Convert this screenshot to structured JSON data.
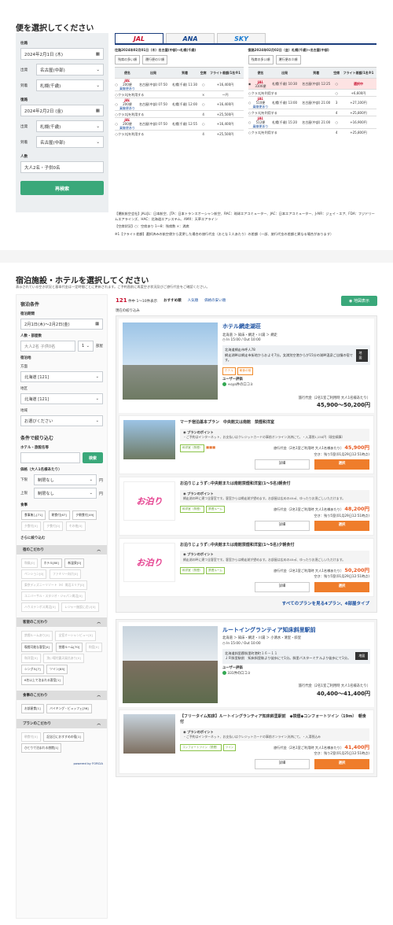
{
  "flight": {
    "title": "便を選択してください",
    "outbound_label": "往路",
    "outbound_date": "2024年2月1日 (木)",
    "dep_label": "出発",
    "arr_label": "到着",
    "out_dep": "名古屋(中部)",
    "out_arr": "札幌(千歳)",
    "return_label": "復路",
    "return_date": "2024年2月2日 (金)",
    "ret_dep": "札幌(千歳)",
    "ret_arr": "名古屋(中部)",
    "people_label": "人数",
    "people_value": "大人2名・子供0名",
    "search_button": "再検索",
    "tabs": [
      "JAL",
      "ANA",
      "SKY"
    ],
    "out_header": "往路2024年02月01日（木）名古屋(中部)→札幌(千歳)",
    "ret_header": "復路2024年02月02日（金）札幌(千歳)→名古屋(中部)",
    "sort_buttons": [
      "残席の多い順",
      "運行便の少順"
    ],
    "cols": [
      "便名",
      "出発",
      "到着",
      "空席",
      "フライト差額/1名※1"
    ],
    "out_rows": [
      {
        "flight": "JAL",
        "no": "200便",
        "link": "乗継便あり",
        "dep": "名古屋(中部) 07:50",
        "arr": "札幌(千歳) 11:30",
        "seat": "○",
        "diff": "+16,400円"
      },
      {
        "cls": "クラスJを利用する",
        "diff": "ー円",
        "seat": "×"
      },
      {
        "flight": "JAL",
        "no": "200便",
        "link": "乗継便あり",
        "dep": "名古屋(中部) 07:50",
        "arr": "札幌(千歳) 12:00",
        "seat": "○",
        "diff": "+16,400円"
      },
      {
        "cls": "クラスJを利用する",
        "seat": "4",
        "diff": "+25,500円"
      },
      {
        "flight": "JAL",
        "no": "200便",
        "link": "乗継便あり",
        "dep": "名古屋(中部) 07:50",
        "arr": "札幌(千歳) 12:55",
        "seat": "○",
        "diff": "+16,400円"
      },
      {
        "cls": "クラスJを利用する",
        "seat": "4",
        "diff": "+25,500円"
      }
    ],
    "ret_rows": [
      {
        "flight": "JAL",
        "no": "3106便",
        "dep": "札幌(千歳) 10:30",
        "arr": "名古屋(中部) 12:25",
        "seat": "○",
        "diff": "選択中"
      },
      {
        "cls": "クラスJを利用する",
        "seat": "○",
        "diff": "+6,600円"
      },
      {
        "flight": "JAL",
        "no": "510便",
        "link": "乗継便あり",
        "dep": "札幌(千歳) 13:00",
        "arr": "名古屋(中部) 21:00",
        "seat": "3",
        "diff": "+27,100円"
      },
      {
        "cls": "クラスJを利用する",
        "seat": "4",
        "diff": "+25,800円"
      },
      {
        "flight": "JAL",
        "no": "512便",
        "link": "乗継便あり",
        "dep": "札幌(千歳) 15:20",
        "arr": "名古屋(中部) 21:00",
        "seat": "○",
        "diff": "+16,900円"
      },
      {
        "cls": "クラスJを利用する",
        "seat": "4",
        "diff": "+25,800円"
      }
    ],
    "note1": "【運航航空会社】JAL/JL：日本航空、JTA：日本トランスオーシャン航空、RAC：琉球エアコミューター、JAC：日本エアコミューター、J-AIR：ジェイ・エア、FDA：フジドリームエアラインズ、HAC：北海道エアシステム、AMX：天草エアライン",
    "note2": "【空席状況】○：空席あり 1～8：残席数 ×：満席",
    "note3": "※1【フライト差額】選択済みの航空便から変更した場合の旅行代金（おとな１人あたり）の差額（一部、旅行代金の差額と異なる場合があります）"
  },
  "hotel": {
    "title": "宿泊施設・ホテルを選択してください",
    "subtitle": "表示されている空き状況と基本代金は一定時間ごとに更新されます。ご予約直前に再度空き状況及びご旅行代金をご確認ください。",
    "cond_title": "宿泊条件",
    "period_label": "宿泊期間",
    "period_value": "2月1日(木)〜2月2日(金)",
    "people_label": "人数・部屋数",
    "people_value": "大人2名 子供0名",
    "rooms_value": "1",
    "rooms_unit": "部屋",
    "area_label": "宿泊地",
    "dir_label": "方面",
    "dir_value": "北海道 [121]",
    "region_label": "地区",
    "region_value": "北海道 [121]",
    "zone_label": "地域",
    "zone_value": "お選びください",
    "narrow_title": "条件で絞り込む",
    "name_label": "ホテル・旅館名等",
    "name_button": "検索",
    "price_label": "価格（大人1名様あたり）",
    "min_label": "下限",
    "min_value": "制限なし",
    "max_label": "上限",
    "max_value": "制限なし",
    "yen": "円",
    "meal_label": "食事",
    "meals": [
      "食事無し[71]",
      "朝食付[67]",
      "夕朝食付[49]",
      "夕食付[0]",
      "夕食付[0]",
      "その他[0]"
    ],
    "more_label": "さらに絞り込む",
    "sections": [
      {
        "title": "宿のこだわり",
        "items": [
          "和風[0]",
          "ホテル[80]",
          "新温泉[0]",
          "ペンション[0]",
          "ファミリー向け[0]",
          "東京ディズニーリゾート（R）周辺エリア[0]",
          "ユニバーサル・スタジオ・ジャパン周辺[0]",
          "ハウステンボス周辺[0]",
          "レジャー施設に近い[0]"
        ]
      },
      {
        "title": "客室のこだわり",
        "items": [
          "禁煙ルームあり[0]",
          "全室オーシャンビュー[0]",
          "喫煙可能な客室[4]",
          "禁煙ルーム[70]",
          "和室[0]",
          "和洋室[0]",
          "洗い場付露天風呂あり[0]",
          "シングル[7]",
          "ツイン[85]",
          "6名以上で泊まれる客室[1]"
        ]
      },
      {
        "title": "食事のこだわり",
        "items": [
          "お部屋食[1]",
          "バイキング・ビュッフェ[36]"
        ]
      },
      {
        "title": "プランのこだわり",
        "items": [
          "朝食付[0]",
          "記念日におすすめの宿[1]",
          "ひとりで泊まれる旅館[1]"
        ]
      }
    ],
    "powered": "powered by FORCIA",
    "count": "121",
    "count_suffix": "件中 1〜10件表示",
    "sort_opts": [
      "おすすめ順",
      "人気順",
      "価格の安い順"
    ],
    "map_btn": "地図表示",
    "filter_label": "現在の絞り込み",
    "hotels": [
      {
        "name": "ホテル網走湖荘",
        "area": "北海道 ＞ 知床・網走・川湯 ＞ 網走",
        "checkin": "In 15:00 / Out 10:00",
        "addr1": "北海道網走市呼人78",
        "addr2": "網走湖畔は網走市街地からおよそ7分。女満別空港からが15分の湖畔温泉ご自慢の宿です。",
        "map": "地図",
        "tags": [
          "ホテル",
          "朝食の宿"
        ],
        "review": "ユーザー評価",
        "review_cnt": "+oya件の口コミ",
        "price_label": "旅行代金（2名1室ご利用時 大人1名様あたり）",
        "price": "45,900〜50,200円",
        "plans": [
          {
            "title": "マーチ宿泊基本プラン　中央館又は南館　禁煙和洋室",
            "point": "プランのポイント",
            "desc": "・ご予約はインターネット、お支払いはクレジットカードの事前オンライン決済にて。・入湯税1,150円（現金精算）",
            "rooms": [
              "和洋室（禁煙）"
            ],
            "plabel": "旅行代金（2名1室ご利用時 大人1名様あたり）",
            "price": "45,900円",
            "stock": "空き：残り5室(01月29日12:51時点)",
            "det": "詳細",
            "sel": "選択"
          },
          {
            "title": "お泊りじょうず◇中央館または南館禁煙和洋室(1〜5名)朝食付",
            "point": "プランのポイント",
            "desc": "網走湖の畔に建つ全客室です。客室からは網走湖が望めます。お部屋は広めの45㎡、ゆったりお過ごしいただけます。",
            "rooms": [
              "和洋室（禁煙）",
              "禁煙ルーム"
            ],
            "plabel": "旅行代金（2名1室ご利用時 大人1名様あたり）",
            "price": "48,200円",
            "stock": "空き：残り5室(01月29日12:51時点)",
            "det": "詳細",
            "sel": "選択"
          },
          {
            "title": "お泊りじょうず◇中央館または南館禁煙和洋室(1〜5名)夕朝食付",
            "point": "プランのポイント",
            "desc": "網走湖の畔に建つ全客室です。客室からは網走湖が望めます。お部屋は広めの45㎡、ゆったりお過ごしいただけます。",
            "rooms": [
              "和洋室（禁煙）",
              "禁煙ルーム"
            ],
            "plabel": "旅行代金（2名1室ご利用時 大人1名様あたり）",
            "price": "50,200円",
            "stock": "空き：残り5室(01月29日12:51時点)",
            "det": "詳細",
            "sel": "選択"
          }
        ],
        "more": "すべてのプランを見る4プラン、4部屋タイプ"
      },
      {
        "name": "ルートイングランティア知床斜里駅前",
        "area": "北海道 ＞ 知床・網走・川湯 ＞ 小清水・清里・斜里",
        "checkin": "In 15:00 / Out 10:00",
        "addr1": "北海道斜里郡斜里町港町１６－１１",
        "addr2": "ＪＲ斜里駅前　知床斜里駅より徒歩にて1分。斜里バスターミナルより徒歩にて1分。",
        "map": "地図",
        "review": "ユーザー評価",
        "review_cnt": "331件の口コミ",
        "price_label": "旅行代金（2名1室ご利用時 大人1名様あたり）",
        "price": "40,400〜41,400円",
        "plans": [
          {
            "title": "【フリータイム知床】ルートイングランティア知床斜里駅前　◆禁煙◆コンフォートツイン（19m）　朝食付",
            "point": "プランのポイント",
            "desc": "・ご予約はインターネット、お支払いはクレジットカードの事前オンライン決済にて。・入湯税込み",
            "rooms": [
              "コンフォートツイン（禁煙）",
              "ツイン"
            ],
            "plabel": "旅行代金（2名1室ご利用時 大人1名様あたり）",
            "price": "41,400円",
            "stock": "空き：残り2室(01月25日12:51時点)",
            "det": "詳細",
            "sel": "選択"
          }
        ]
      }
    ]
  },
  "colors": {
    "green": "#3aa87a",
    "jal_red": "#c8102e",
    "orange": "#ef7d2b",
    "link_blue": "#1a4fa0"
  }
}
